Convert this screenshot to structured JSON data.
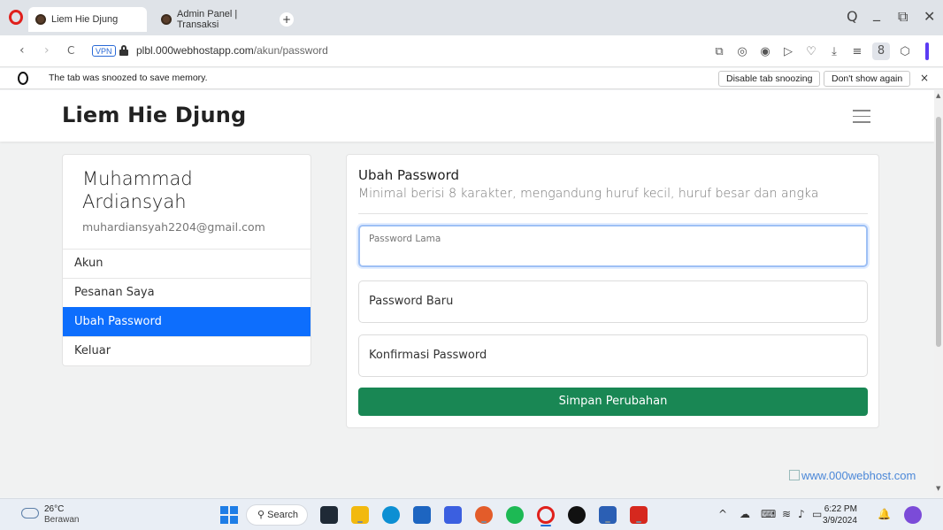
{
  "browser": {
    "tabs": [
      {
        "title": "Liem Hie Djung",
        "active": true
      },
      {
        "title": "Admin Panel | Transaksi",
        "active": false
      }
    ],
    "new_tab": "+",
    "window_controls": {
      "search": "Q",
      "minimize": "_",
      "restore": "⧉",
      "close": "✕"
    },
    "nav": {
      "back": "‹",
      "forward": "›",
      "reload": "C"
    },
    "vpn_label": "VPN",
    "url_host": "plbl.000webhostapp.com",
    "url_path": "/akun/password",
    "toolbar_icons": [
      "⧉",
      "◎",
      "◉",
      "▷",
      "♡",
      "⤓",
      "≡",
      "8",
      "⬡"
    ]
  },
  "snooze": {
    "message": "The tab was snoozed to save memory.",
    "disable_label": "Disable tab snoozing",
    "dont_show_label": "Don't show again",
    "close": "×"
  },
  "site": {
    "brand": "Liem Hie Djung"
  },
  "profile": {
    "name": "Muhammad Ardiansyah",
    "email": "muhardiansyah2204@gmail.com",
    "menu": [
      {
        "label": "Akun",
        "active": false
      },
      {
        "label": "Pesanan Saya",
        "active": false
      },
      {
        "label": "Ubah Password",
        "active": true
      },
      {
        "label": "Keluar",
        "active": false
      }
    ]
  },
  "form": {
    "title": "Ubah Password",
    "subtitle": "Minimal berisi 8 karakter, mengandung huruf kecil, huruf besar dan angka",
    "old_password_label": "Password Lama",
    "new_password_label": "Password Baru",
    "confirm_password_label": "Konfirmasi Password",
    "submit_label": "Simpan Perubahan"
  },
  "watermark": "www.000webhost.com",
  "taskbar": {
    "weather_temp": "26°C",
    "weather_cond": "Berawan",
    "search_label": "Search",
    "time": "6:22 PM",
    "date": "3/9/2024"
  },
  "colors": {
    "primary": "#0d6efd",
    "success": "#198754",
    "opera_red": "#e0201c"
  }
}
